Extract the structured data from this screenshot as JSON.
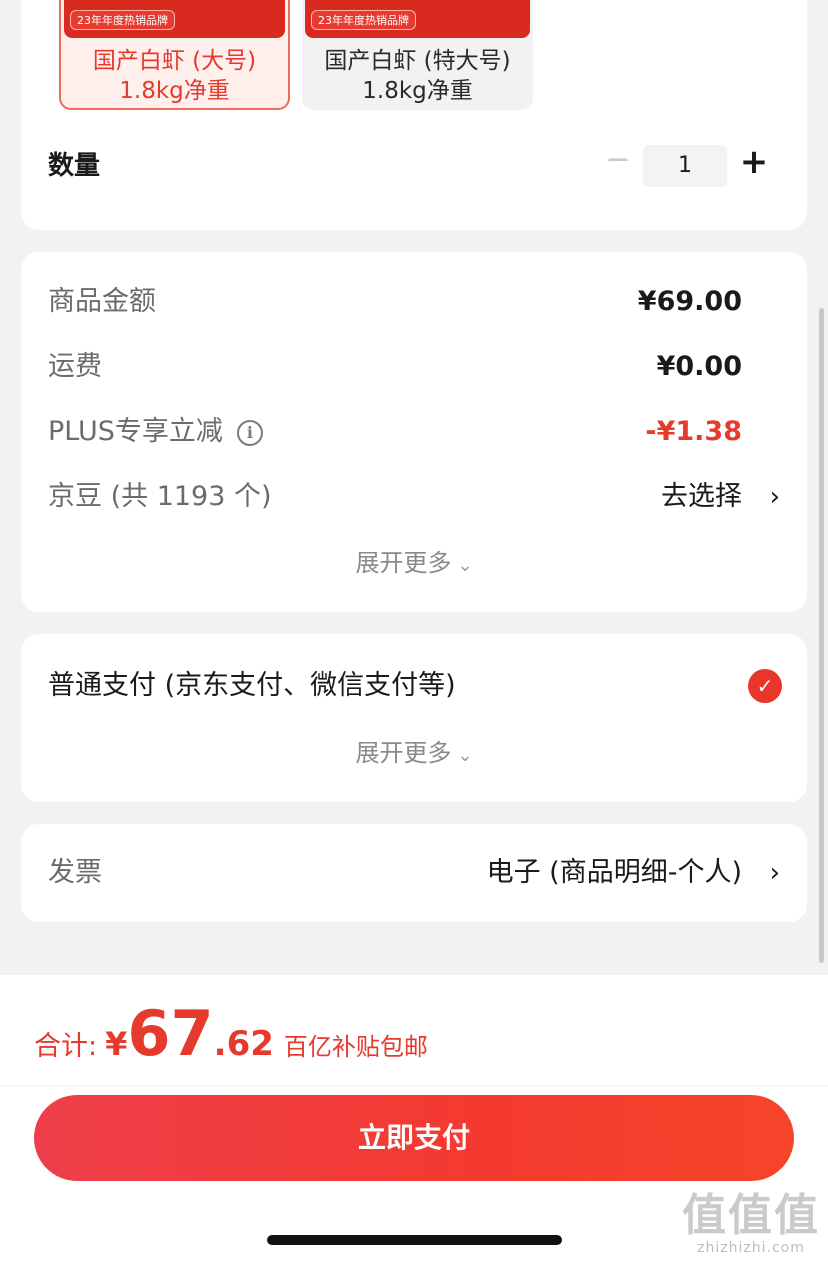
{
  "variants": [
    {
      "tag": "23年年度热销品牌",
      "name": "国产白虾 (大号)",
      "weight": "1.8kg净重",
      "selected": true
    },
    {
      "tag": "23年年度热销品牌",
      "name": "国产白虾 (特大号)",
      "weight": "1.8kg净重",
      "selected": false
    }
  ],
  "quantity": {
    "label": "数量",
    "minus": "−",
    "value": "1",
    "plus": "+"
  },
  "price_summary": {
    "goods_label": "商品金额",
    "goods_value": "¥69.00",
    "shipping_label": "运费",
    "shipping_value": "¥0.00",
    "plus_label": "PLUS专享立减",
    "plus_value": "-¥1.38",
    "jingdou_label": "京豆 (共 1193 个)",
    "jingdou_action": "去选择",
    "expand_label": "展开更多"
  },
  "payment": {
    "method_label": "普通支付 (京东支付、微信支付等)",
    "expand_label": "展开更多"
  },
  "invoice": {
    "label": "发票",
    "value": "电子 (商品明细-个人)"
  },
  "total": {
    "label": "合计:",
    "currency": "¥",
    "integer": "67",
    "decimal": ".62",
    "note": "百亿补贴包邮"
  },
  "pay_button": {
    "label": "立即支付"
  },
  "watermark": {
    "big": "值值值",
    "small": "zhizhizhi.com"
  },
  "colors": {
    "accent": "#e53a2c",
    "button": "#f43a2f"
  }
}
